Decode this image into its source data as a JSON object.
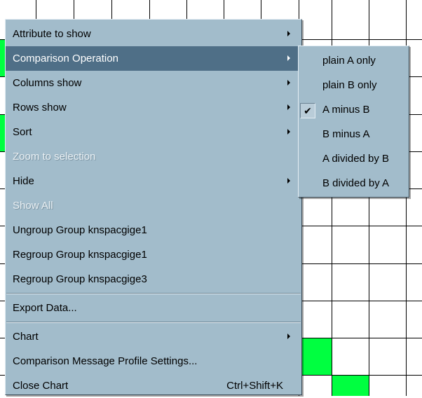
{
  "main_menu": {
    "items": [
      {
        "label": "Attribute to show",
        "submenu": true
      },
      {
        "label": "Comparison Operation",
        "submenu": true
      },
      {
        "label": "Columns show",
        "submenu": true
      },
      {
        "label": "Rows show",
        "submenu": true
      },
      {
        "label": "Sort",
        "submenu": true
      },
      {
        "label": "Zoom to selection",
        "disabled": true
      },
      {
        "label": "Hide",
        "submenu": true
      },
      {
        "label": "Show All",
        "disabled": true
      },
      {
        "label": "Ungroup Group knspacgige1"
      },
      {
        "label": "Regroup Group knspacgige1"
      },
      {
        "label": "Regroup Group knspacgige3"
      },
      {
        "label": "Export Data..."
      },
      {
        "label": "Chart",
        "submenu": true
      },
      {
        "label": "Comparison Message Profile Settings..."
      },
      {
        "label": "Close Chart",
        "shortcut": "Ctrl+Shift+K"
      }
    ]
  },
  "sub_menu": {
    "items": [
      {
        "label": "plain A only"
      },
      {
        "label": "plain B only"
      },
      {
        "label": "A minus B",
        "checked": true
      },
      {
        "label": "B minus A"
      },
      {
        "label": "A divided by B"
      },
      {
        "label": "B divided by A"
      }
    ]
  },
  "colors": {
    "menu_bg": "#a2bccb",
    "highlight": "#4f6f87",
    "grid_fill": "#00ff40"
  }
}
